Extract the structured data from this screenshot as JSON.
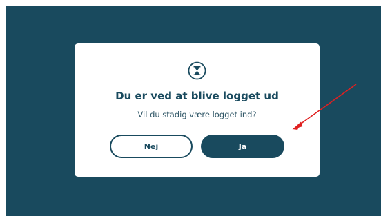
{
  "dialog": {
    "icon": "hourglass-icon",
    "title": "Du er ved at blive logget ud",
    "subtitle": "Vil du stadig være logget ind?",
    "no_label": "Nej",
    "yes_label": "Ja"
  },
  "colors": {
    "backdrop": "#194a5e",
    "accent": "#194a5e",
    "annotation_arrow": "#e02020"
  }
}
